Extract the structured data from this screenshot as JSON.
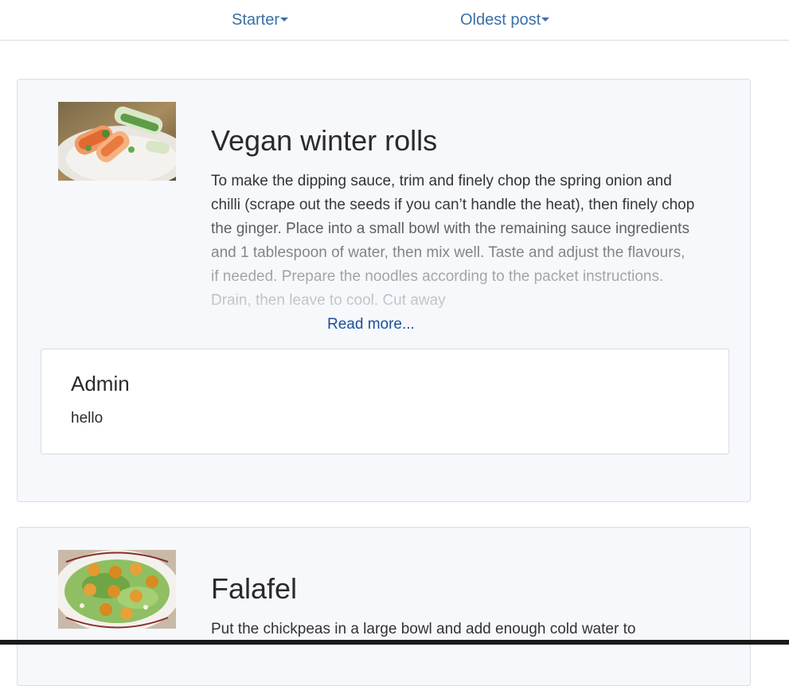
{
  "nav": {
    "category_label": "Starter",
    "sort_label": "Oldest post"
  },
  "posts": [
    {
      "title": "Vegan winter rolls",
      "image_icon": "spring-rolls-photo",
      "excerpt": "To make the dipping sauce, trim and finely chop the spring onion and chilli (scrape out the seeds if you can’t handle the heat), then finely chop the ginger. Place into a small bowl with the remaining sauce ingredients and 1 tablespoon of water, then mix well. Taste and adjust the flavours, if needed. Prepare the noodles according to the packet instructions. Drain, then leave to cool. Cut away",
      "read_more": "Read more...",
      "comment": {
        "author": "Admin",
        "text": "hello"
      }
    },
    {
      "title": "Falafel",
      "image_icon": "falafel-salad-photo",
      "excerpt": "Put the chickpeas in a large bowl and add enough cold water to"
    }
  ],
  "colors": {
    "link": "#3a6fa8",
    "read_more": "#1b4f9a",
    "card_bg": "#f6f8fc"
  }
}
